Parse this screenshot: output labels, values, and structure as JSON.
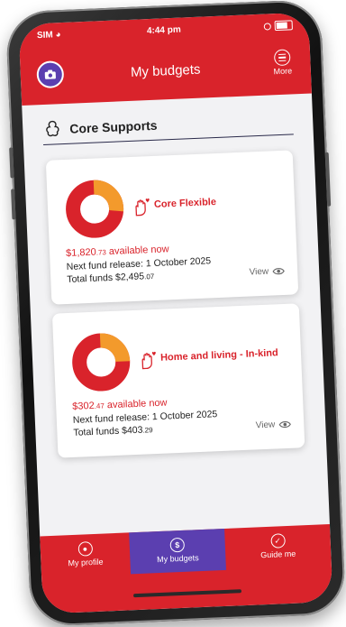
{
  "status": {
    "carrier": "SIM",
    "time": "4:44 pm"
  },
  "header": {
    "title": "My budgets",
    "more_label": "More"
  },
  "section": {
    "title": "Core Supports"
  },
  "budgets": [
    {
      "name": "Core Flexible",
      "available_main": "$1,820",
      "available_cents": ".73",
      "available_suffix": " available now",
      "next_release": "Next fund release: 1 October 2025",
      "total_prefix": "Total funds ",
      "total_main": "$2,495",
      "total_cents": ".07",
      "view_label": "View",
      "used_fraction": 0.27
    },
    {
      "name": "Home and living - In-kind",
      "available_main": "$302",
      "available_cents": ".47",
      "available_suffix": " available now",
      "next_release": "Next fund release: 1 October 2025",
      "total_prefix": "Total funds ",
      "total_main": "$403",
      "total_cents": ".29",
      "view_label": "View",
      "used_fraction": 0.25
    }
  ],
  "tabs": [
    {
      "label": "My profile"
    },
    {
      "label": "My budgets"
    },
    {
      "label": "Guide me"
    }
  ],
  "colors": {
    "brand_red": "#d9232b",
    "active_purple": "#5b3fb0",
    "used_orange": "#f39a2c"
  }
}
